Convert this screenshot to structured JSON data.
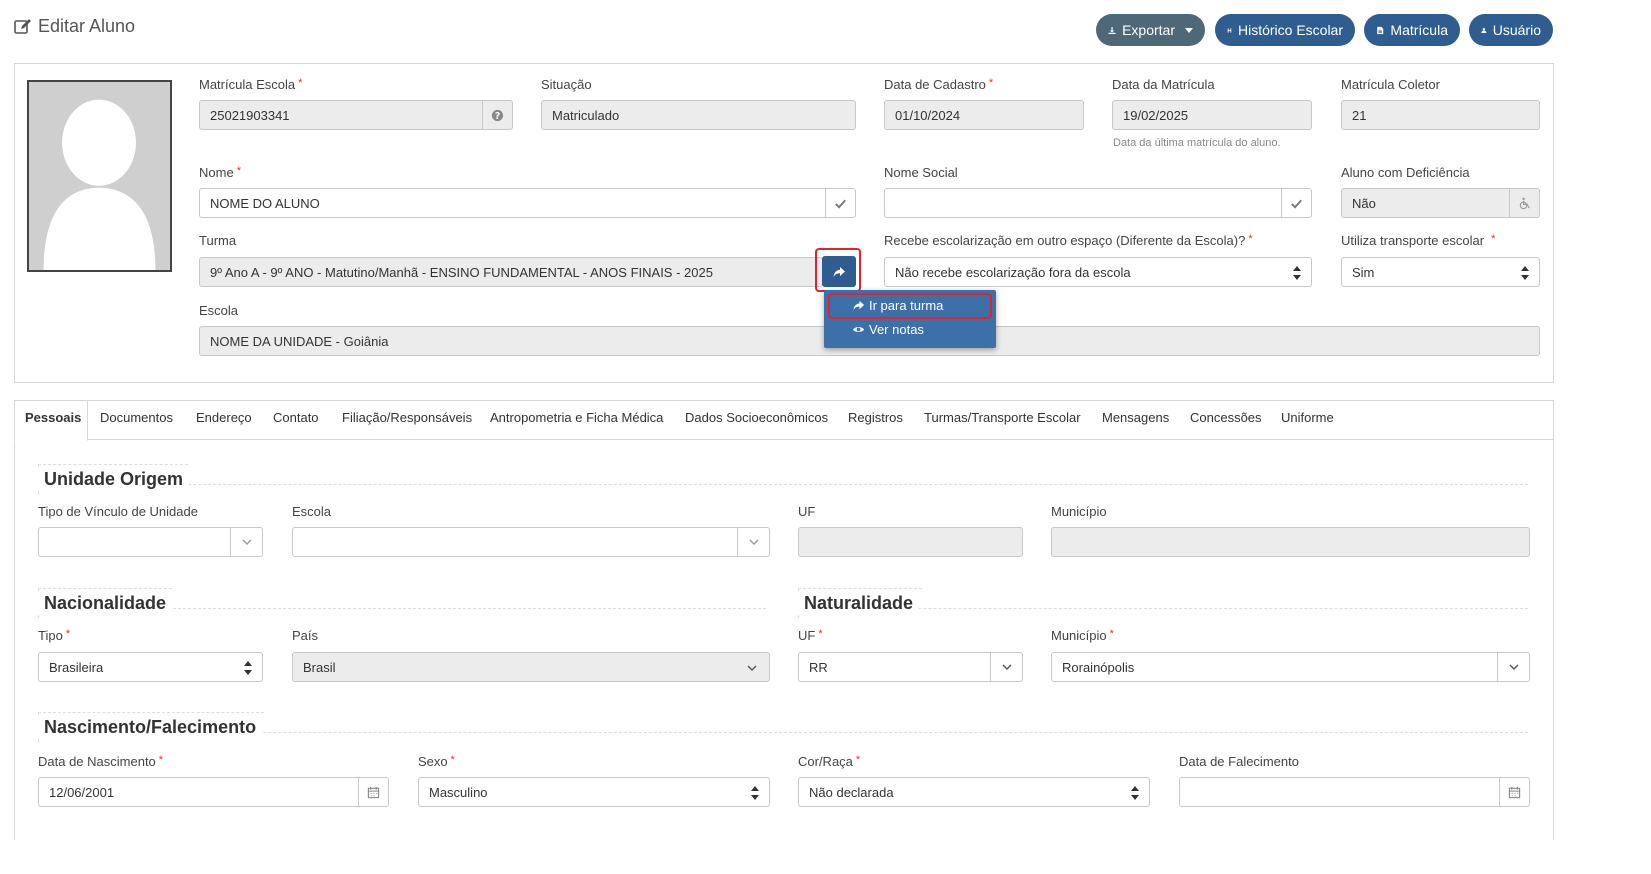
{
  "header": {
    "title": "Editar Aluno",
    "buttons": {
      "exportar": "Exportar",
      "historico": "Histórico Escolar",
      "matricula": "Matrícula",
      "usuario": "Usuário"
    }
  },
  "student": {
    "matricula_escola": {
      "label": "Matrícula Escola",
      "value": "25021903341"
    },
    "situacao": {
      "label": "Situação",
      "value": "Matriculado"
    },
    "data_cadastro": {
      "label": "Data de Cadastro",
      "value": "01/10/2024"
    },
    "data_matricula": {
      "label": "Data da Matrícula",
      "value": "19/02/2025",
      "hint": "Data da última matrícula do aluno."
    },
    "matricula_coletor": {
      "label": "Matrícula Coletor",
      "value": "21"
    },
    "nome": {
      "label": "Nome",
      "value": "NOME DO ALUNO"
    },
    "nome_social": {
      "label": "Nome Social",
      "value": ""
    },
    "deficiencia": {
      "label": "Aluno com Deficiência",
      "value": "Não"
    },
    "turma": {
      "label": "Turma",
      "value": "9º Ano A - 9º ANO - Matutino/Manhã - ENSINO FUNDAMENTAL - ANOS FINAIS - 2025"
    },
    "escolarizacao": {
      "label": "Recebe escolarização em outro espaço (Diferente da Escola)?",
      "value": "Não recebe escolarização fora da escola"
    },
    "transporte": {
      "label": "Utiliza transporte escolar",
      "value": "Sim"
    },
    "escola": {
      "label": "Escola",
      "value": "NOME DA UNIDADE - Goiânia"
    }
  },
  "turma_menu": {
    "items": [
      "Ir para turma",
      "Ver notas"
    ]
  },
  "tabs": [
    "Pessoais",
    "Documentos",
    "Endereço",
    "Contato",
    "Filiação/Responsáveis",
    "Antropometria e Ficha Médica",
    "Dados Socioeconômicos",
    "Registros",
    "Turmas/Transporte Escolar",
    "Mensagens",
    "Concessões",
    "Uniforme"
  ],
  "sections": {
    "unidade_origem": {
      "title": "Unidade Origem",
      "tipo_vinculo": {
        "label": "Tipo de Vínculo de Unidade",
        "value": ""
      },
      "escola": {
        "label": "Escola",
        "value": ""
      },
      "uf": {
        "label": "UF",
        "value": ""
      },
      "municipio": {
        "label": "Município",
        "value": ""
      }
    },
    "nacionalidade": {
      "title": "Nacionalidade",
      "tipo": {
        "label": "Tipo",
        "value": "Brasileira"
      },
      "pais": {
        "label": "País",
        "value": "Brasil"
      }
    },
    "naturalidade": {
      "title": "Naturalidade",
      "uf": {
        "label": "UF",
        "value": "RR"
      },
      "municipio": {
        "label": "Município",
        "value": "Rorainópolis"
      }
    },
    "nascimento": {
      "title": "Nascimento/Falecimento",
      "data_nascimento": {
        "label": "Data de Nascimento",
        "value": "12/06/2001"
      },
      "sexo": {
        "label": "Sexo",
        "value": "Masculino"
      },
      "cor_raca": {
        "label": "Cor/Raça",
        "value": "Não declarada"
      },
      "data_falecimento": {
        "label": "Data de Falecimento",
        "value": ""
      }
    }
  },
  "required_mark": "*"
}
